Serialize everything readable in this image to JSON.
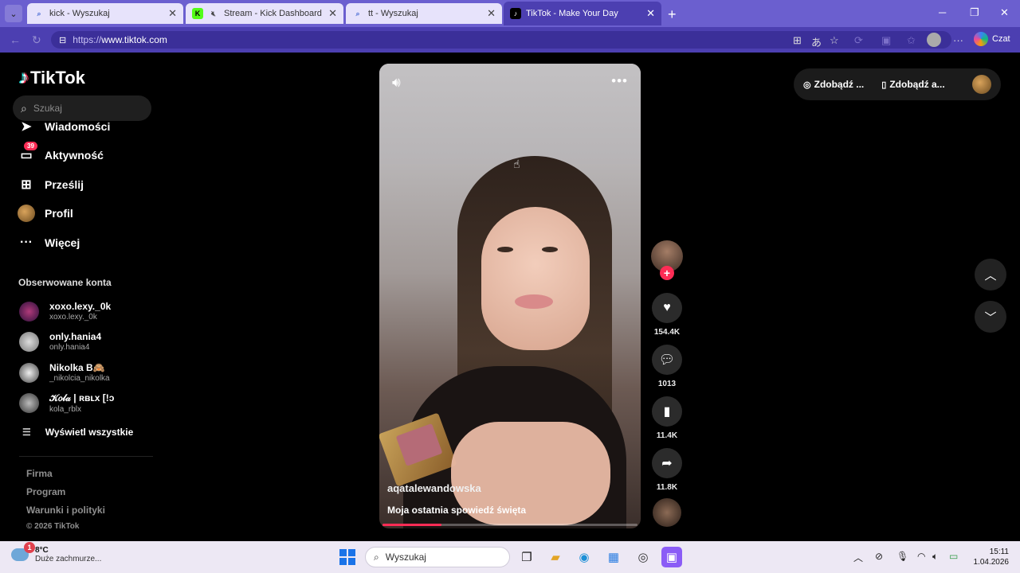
{
  "browser": {
    "tabs": [
      {
        "title": "kick - Wyszukaj",
        "active": false
      },
      {
        "title": "Stream - Kick Dashboard",
        "active": false
      },
      {
        "title": "tt - Wyszukaj",
        "active": false
      },
      {
        "title": "TikTok - Make Your Day",
        "active": true
      }
    ],
    "url_prefix": "https://",
    "url_host": "www.tiktok.com",
    "copilot_label": "Czat"
  },
  "sidebar": {
    "brand": "TikTok",
    "search_placeholder": "Szukaj",
    "nav": [
      {
        "label": "Wiadomości",
        "icon": "send-icon"
      },
      {
        "label": "Aktywność",
        "icon": "inbox-icon",
        "badge": "39"
      },
      {
        "label": "Prześlij",
        "icon": "upload-icon"
      },
      {
        "label": "Profil",
        "icon": "profile-avatar"
      },
      {
        "label": "Więcej",
        "icon": "more-icon"
      }
    ],
    "following_title": "Obserwowane konta",
    "following": [
      {
        "name": "xoxo.lexy._0k",
        "username": "xoxo.lexy._0k"
      },
      {
        "name": "only.hania4",
        "username": "only.hania4"
      },
      {
        "name": "Nikolka B🙈",
        "username": "_nikolcia_nikolka"
      },
      {
        "name": "𝒦𝑜𝓁𝒶 | ʀʙʟx [!ɔ",
        "username": "kola_rblx"
      }
    ],
    "see_all": "Wyświetl wszystkie",
    "footer": [
      "Firma",
      "Program",
      "Warunki i polityki"
    ],
    "copyright": "© 2026 TikTok"
  },
  "video": {
    "author": "aqatalewandowska",
    "caption": "Moja ostatnia spowiedź święta",
    "progress": 0.23
  },
  "actions": {
    "likes": "154.4K",
    "comments": "1013",
    "saves": "11.4K",
    "shares": "11.8K"
  },
  "top_right": {
    "item1": "Zdobądź ...",
    "item2": "Zdobądź a..."
  },
  "taskbar": {
    "temperature": "8°C",
    "weather": "Duże zachmurze...",
    "weather_badge": "1",
    "search": "Wyszukaj",
    "time": "15:11",
    "date": "1.04.2026"
  }
}
